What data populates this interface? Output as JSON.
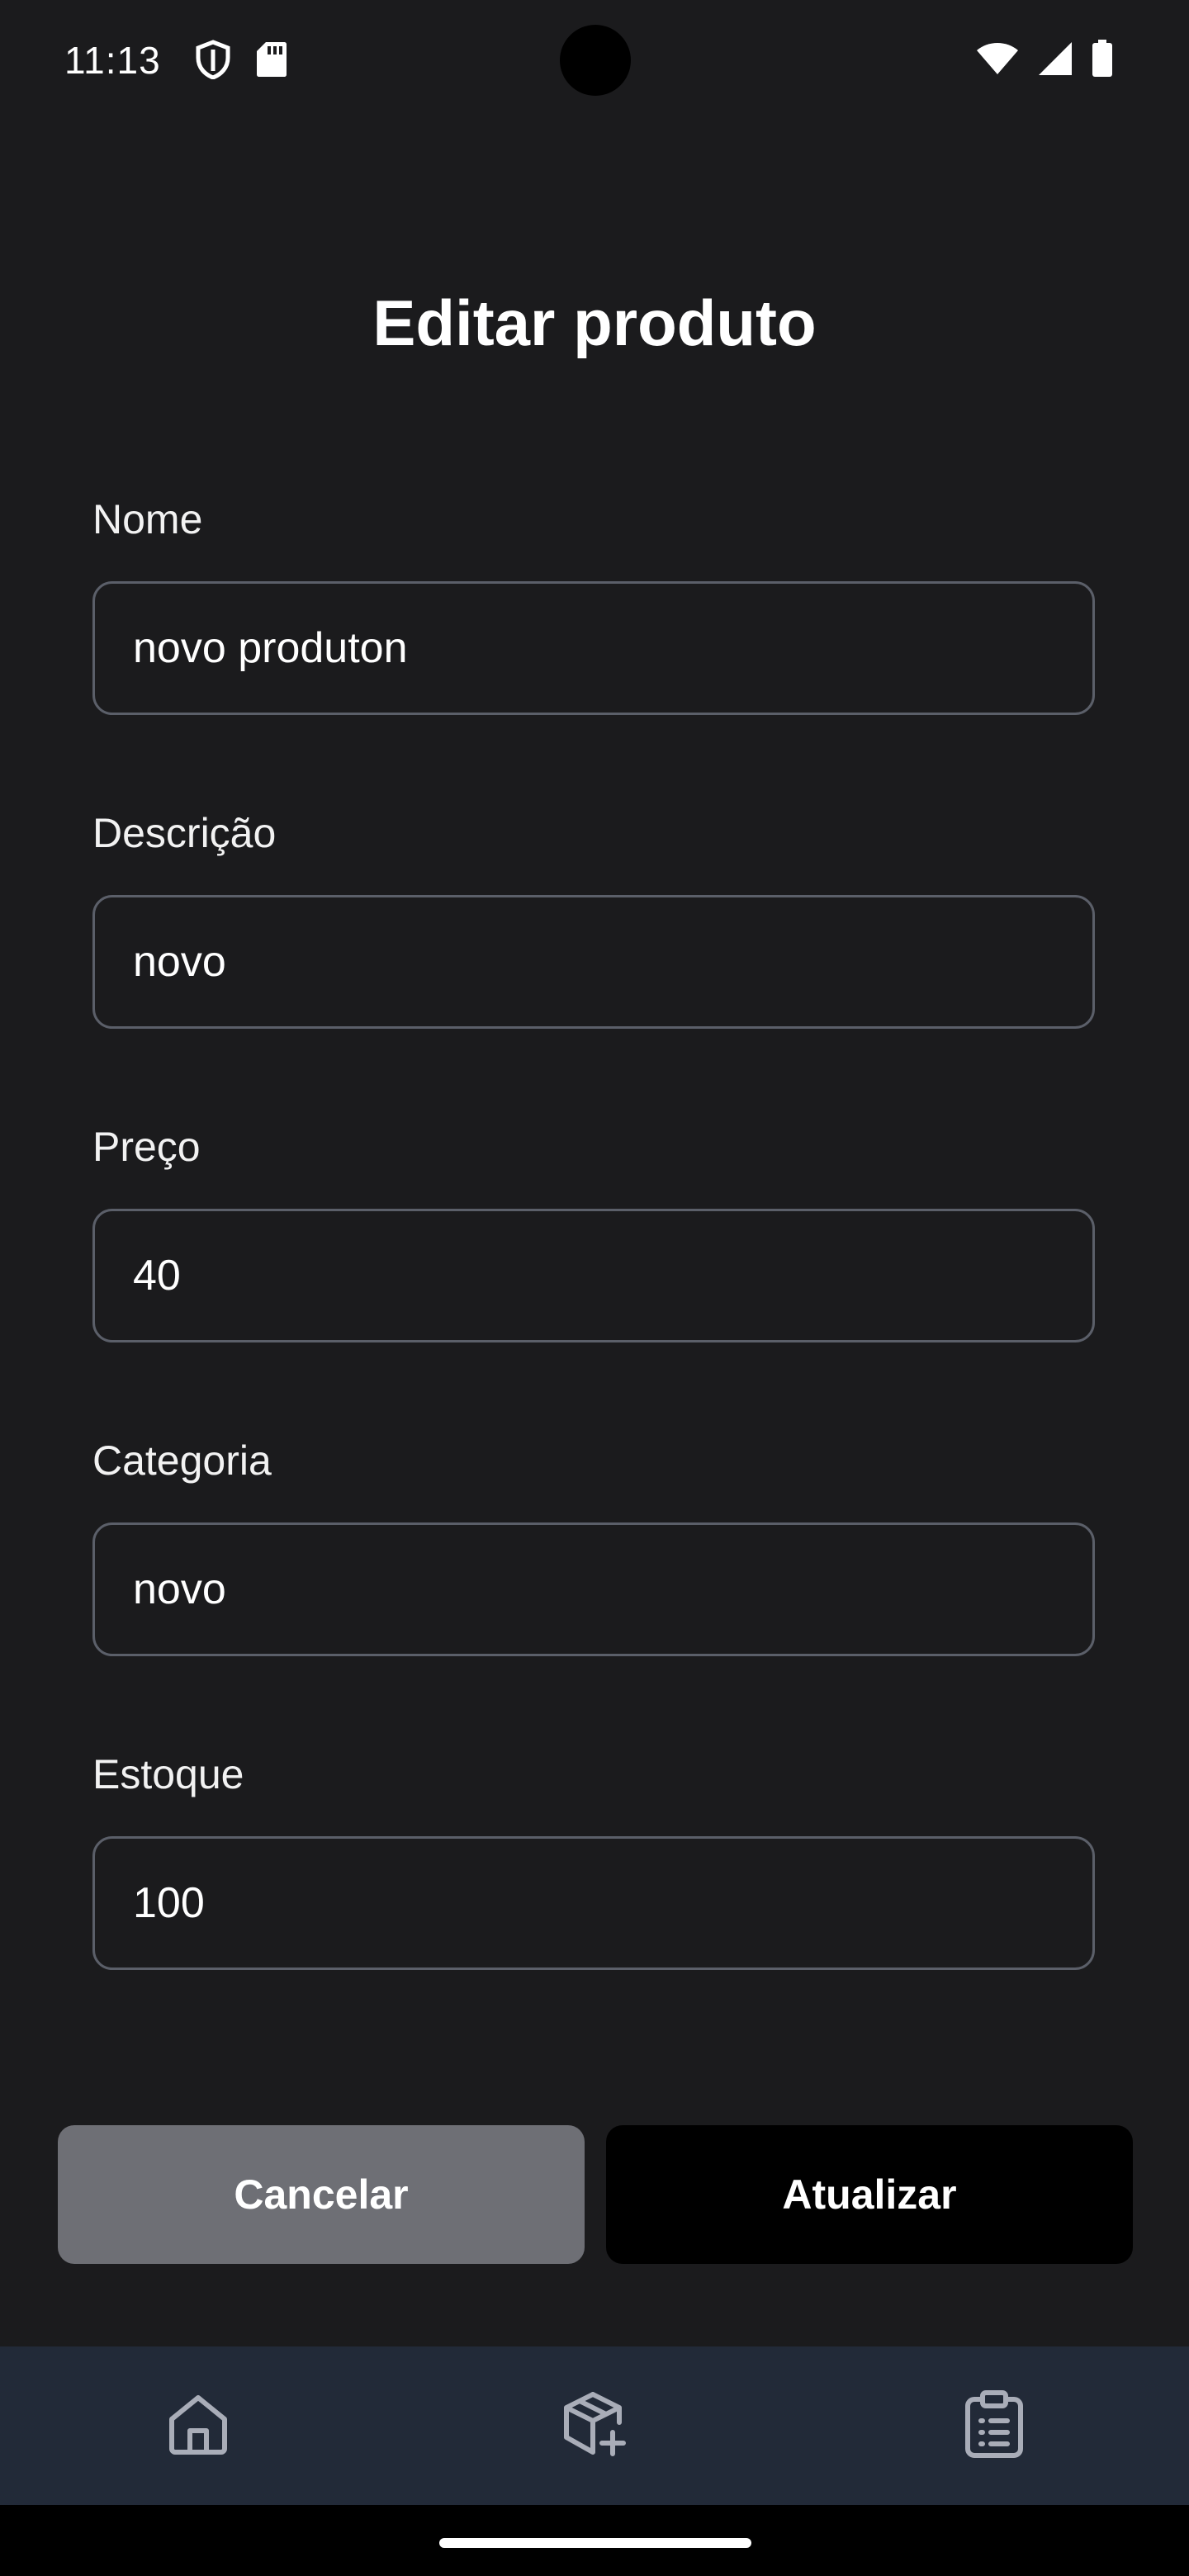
{
  "status_bar": {
    "time": "11:13",
    "left_icons": [
      "shield-icon",
      "sd-card-icon"
    ],
    "right_icons": [
      "wifi-icon",
      "signal-icon",
      "battery-icon"
    ]
  },
  "header": {
    "title": "Editar produto"
  },
  "form": {
    "fields": [
      {
        "label": "Nome",
        "value": "novo produton"
      },
      {
        "label": "Descrição",
        "value": "novo"
      },
      {
        "label": "Preço",
        "value": "40"
      },
      {
        "label": "Categoria",
        "value": "novo"
      },
      {
        "label": "Estoque",
        "value": "100"
      }
    ]
  },
  "actions": {
    "cancel_label": "Cancelar",
    "update_label": "Atualizar"
  },
  "bottom_nav": {
    "items": [
      "home-icon",
      "package-add-icon",
      "clipboard-list-icon"
    ]
  },
  "colors": {
    "background": "#1b1b1d",
    "field_border": "#5b5f69",
    "cancel_button": "#6e6f75",
    "update_button": "#000000",
    "bottom_nav": "#222a38"
  }
}
